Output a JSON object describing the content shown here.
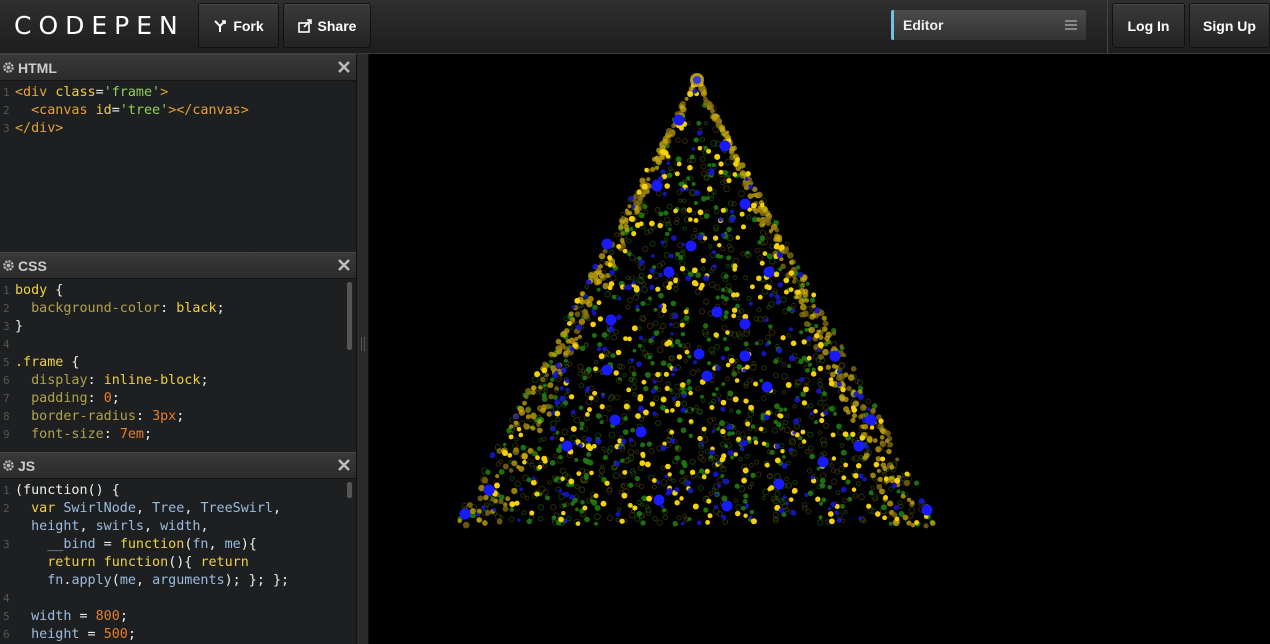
{
  "header": {
    "logo": "CODEPEN",
    "fork_label": "Fork",
    "share_label": "Share",
    "view_select": "Editor",
    "login_label": "Log In",
    "signup_label": "Sign Up"
  },
  "panels": {
    "html": {
      "title": "HTML"
    },
    "css": {
      "title": "CSS"
    },
    "js": {
      "title": "JS"
    }
  },
  "html_code": [
    {
      "n": "1",
      "parts": [
        [
          "tag",
          "<div "
        ],
        [
          "attr",
          "class"
        ],
        [
          "plain",
          "="
        ],
        [
          "str",
          "'frame'"
        ],
        [
          "tag",
          ">"
        ]
      ]
    },
    {
      "n": "2",
      "parts": [
        [
          "plain",
          "  "
        ],
        [
          "tag",
          "<canvas "
        ],
        [
          "attr",
          "id"
        ],
        [
          "plain",
          "="
        ],
        [
          "str",
          "'tree'"
        ],
        [
          "tag",
          "></canvas>"
        ]
      ]
    },
    {
      "n": "3",
      "parts": [
        [
          "tag",
          "</div>"
        ]
      ]
    }
  ],
  "css_code": [
    {
      "n": "1",
      "parts": [
        [
          "sel",
          "body"
        ],
        [
          "plain",
          " {"
        ]
      ]
    },
    {
      "n": "2",
      "parts": [
        [
          "plain",
          "  "
        ],
        [
          "prop",
          "background-color"
        ],
        [
          "plain",
          ": "
        ],
        [
          "val",
          "black"
        ],
        [
          "plain",
          ";"
        ]
      ]
    },
    {
      "n": "3",
      "parts": [
        [
          "plain",
          "}"
        ]
      ]
    },
    {
      "n": "4",
      "parts": []
    },
    {
      "n": "5",
      "parts": [
        [
          "sel",
          ".frame"
        ],
        [
          "plain",
          " {"
        ]
      ]
    },
    {
      "n": "6",
      "parts": [
        [
          "plain",
          "  "
        ],
        [
          "prop",
          "display"
        ],
        [
          "plain",
          ": "
        ],
        [
          "val",
          "inline-block"
        ],
        [
          "plain",
          ";"
        ]
      ]
    },
    {
      "n": "7",
      "parts": [
        [
          "plain",
          "  "
        ],
        [
          "prop",
          "padding"
        ],
        [
          "plain",
          ": "
        ],
        [
          "num",
          "0"
        ],
        [
          "plain",
          ";"
        ]
      ]
    },
    {
      "n": "8",
      "parts": [
        [
          "plain",
          "  "
        ],
        [
          "prop",
          "border-radius"
        ],
        [
          "plain",
          ": "
        ],
        [
          "num",
          "3px"
        ],
        [
          "plain",
          ";"
        ]
      ]
    },
    {
      "n": "9",
      "parts": [
        [
          "plain",
          "  "
        ],
        [
          "prop",
          "font-size"
        ],
        [
          "plain",
          ": "
        ],
        [
          "num",
          "7em"
        ],
        [
          "plain",
          ";"
        ]
      ]
    }
  ],
  "js_code": [
    {
      "n": "1",
      "parts": [
        [
          "plain",
          "(function() {"
        ]
      ]
    },
    {
      "n": "2",
      "parts": [
        [
          "plain",
          "  "
        ],
        [
          "kw",
          "var"
        ],
        [
          "plain",
          " "
        ],
        [
          "var",
          "SwirlNode"
        ],
        [
          "plain",
          ", "
        ],
        [
          "var",
          "Tree"
        ],
        [
          "plain",
          ", "
        ],
        [
          "var",
          "TreeSwirl"
        ],
        [
          "plain",
          ","
        ]
      ]
    },
    {
      "n": "",
      "parts": [
        [
          "plain",
          "  "
        ],
        [
          "var",
          "height"
        ],
        [
          "plain",
          ", "
        ],
        [
          "var",
          "swirls"
        ],
        [
          "plain",
          ", "
        ],
        [
          "var",
          "width"
        ],
        [
          "plain",
          ","
        ]
      ]
    },
    {
      "n": "3",
      "parts": [
        [
          "plain",
          "    "
        ],
        [
          "var",
          "__bind"
        ],
        [
          "plain",
          " = "
        ],
        [
          "kw",
          "function"
        ],
        [
          "plain",
          "("
        ],
        [
          "var",
          "fn"
        ],
        [
          "plain",
          ", "
        ],
        [
          "var",
          "me"
        ],
        [
          "plain",
          "){"
        ]
      ]
    },
    {
      "n": "",
      "parts": [
        [
          "plain",
          "    "
        ],
        [
          "kw",
          "return function"
        ],
        [
          "plain",
          "(){ "
        ],
        [
          "kw",
          "return"
        ]
      ]
    },
    {
      "n": "",
      "parts": [
        [
          "plain",
          "    "
        ],
        [
          "var",
          "fn"
        ],
        [
          "plain",
          "."
        ],
        [
          "var",
          "apply"
        ],
        [
          "plain",
          "("
        ],
        [
          "var",
          "me"
        ],
        [
          "plain",
          ", "
        ],
        [
          "var",
          "arguments"
        ],
        [
          "plain",
          "); }; };"
        ]
      ]
    },
    {
      "n": "4",
      "parts": []
    },
    {
      "n": "5",
      "parts": [
        [
          "plain",
          "  "
        ],
        [
          "var",
          "width"
        ],
        [
          "plain",
          " = "
        ],
        [
          "num",
          "800"
        ],
        [
          "plain",
          ";"
        ]
      ]
    },
    {
      "n": "6",
      "parts": [
        [
          "plain",
          "  "
        ],
        [
          "var",
          "height"
        ],
        [
          "plain",
          " = "
        ],
        [
          "num",
          "500"
        ],
        [
          "plain",
          ";"
        ]
      ]
    }
  ],
  "colors": {
    "accent": "#6fc1e8",
    "light_blue": "#1a1aff",
    "light_yellow": "#f5d10a",
    "light_green": "#1f7a12"
  }
}
